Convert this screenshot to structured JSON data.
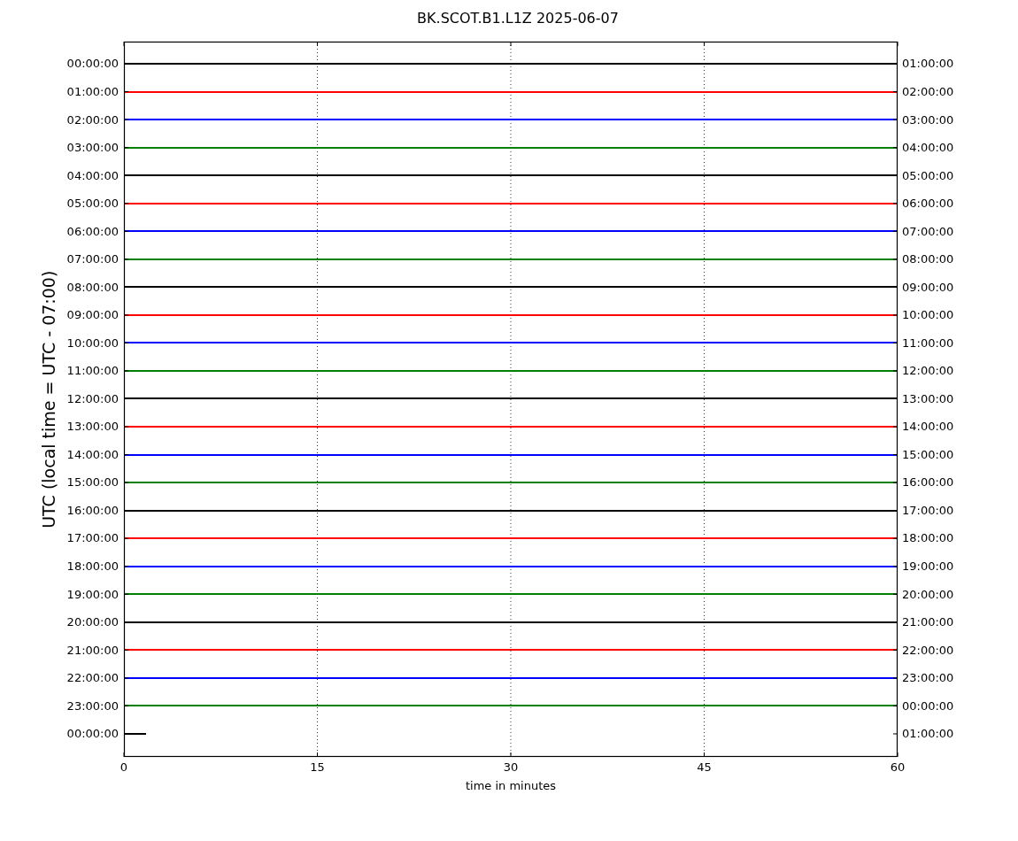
{
  "title": "BK.SCOT.B1.L1Z 2025-06-07",
  "ylabel": "UTC (local time = UTC - 07:00)",
  "xlabel": "time in minutes",
  "xticks": [
    "0",
    "15",
    "30",
    "45",
    "60"
  ],
  "traces": [
    {
      "left": "00:00:00",
      "right": "01:00:00",
      "color": "#000000",
      "kind": "full"
    },
    {
      "left": "01:00:00",
      "right": "02:00:00",
      "color": "#ff0000",
      "kind": "full"
    },
    {
      "left": "02:00:00",
      "right": "03:00:00",
      "color": "#0000ff",
      "kind": "full"
    },
    {
      "left": "03:00:00",
      "right": "04:00:00",
      "color": "#008000",
      "kind": "full"
    },
    {
      "left": "04:00:00",
      "right": "05:00:00",
      "color": "#000000",
      "kind": "full"
    },
    {
      "left": "05:00:00",
      "right": "06:00:00",
      "color": "#ff0000",
      "kind": "full"
    },
    {
      "left": "06:00:00",
      "right": "07:00:00",
      "color": "#0000ff",
      "kind": "full"
    },
    {
      "left": "07:00:00",
      "right": "08:00:00",
      "color": "#008000",
      "kind": "full"
    },
    {
      "left": "08:00:00",
      "right": "09:00:00",
      "color": "#000000",
      "kind": "full"
    },
    {
      "left": "09:00:00",
      "right": "10:00:00",
      "color": "#ff0000",
      "kind": "full"
    },
    {
      "left": "10:00:00",
      "right": "11:00:00",
      "color": "#0000ff",
      "kind": "full"
    },
    {
      "left": "11:00:00",
      "right": "12:00:00",
      "color": "#008000",
      "kind": "full"
    },
    {
      "left": "12:00:00",
      "right": "13:00:00",
      "color": "#000000",
      "kind": "full"
    },
    {
      "left": "13:00:00",
      "right": "14:00:00",
      "color": "#ff0000",
      "kind": "full"
    },
    {
      "left": "14:00:00",
      "right": "15:00:00",
      "color": "#0000ff",
      "kind": "full"
    },
    {
      "left": "15:00:00",
      "right": "16:00:00",
      "color": "#008000",
      "kind": "full"
    },
    {
      "left": "16:00:00",
      "right": "17:00:00",
      "color": "#000000",
      "kind": "full"
    },
    {
      "left": "17:00:00",
      "right": "18:00:00",
      "color": "#ff0000",
      "kind": "full"
    },
    {
      "left": "18:00:00",
      "right": "19:00:00",
      "color": "#0000ff",
      "kind": "full"
    },
    {
      "left": "19:00:00",
      "right": "20:00:00",
      "color": "#008000",
      "kind": "full"
    },
    {
      "left": "20:00:00",
      "right": "21:00:00",
      "color": "#000000",
      "kind": "full"
    },
    {
      "left": "21:00:00",
      "right": "22:00:00",
      "color": "#ff0000",
      "kind": "full"
    },
    {
      "left": "22:00:00",
      "right": "23:00:00",
      "color": "#0000ff",
      "kind": "full"
    },
    {
      "left": "23:00:00",
      "right": "00:00:00",
      "color": "#008000",
      "kind": "full"
    },
    {
      "left": "00:00:00",
      "right": "01:00:00",
      "color": "#000000",
      "kind": "partial"
    }
  ]
}
